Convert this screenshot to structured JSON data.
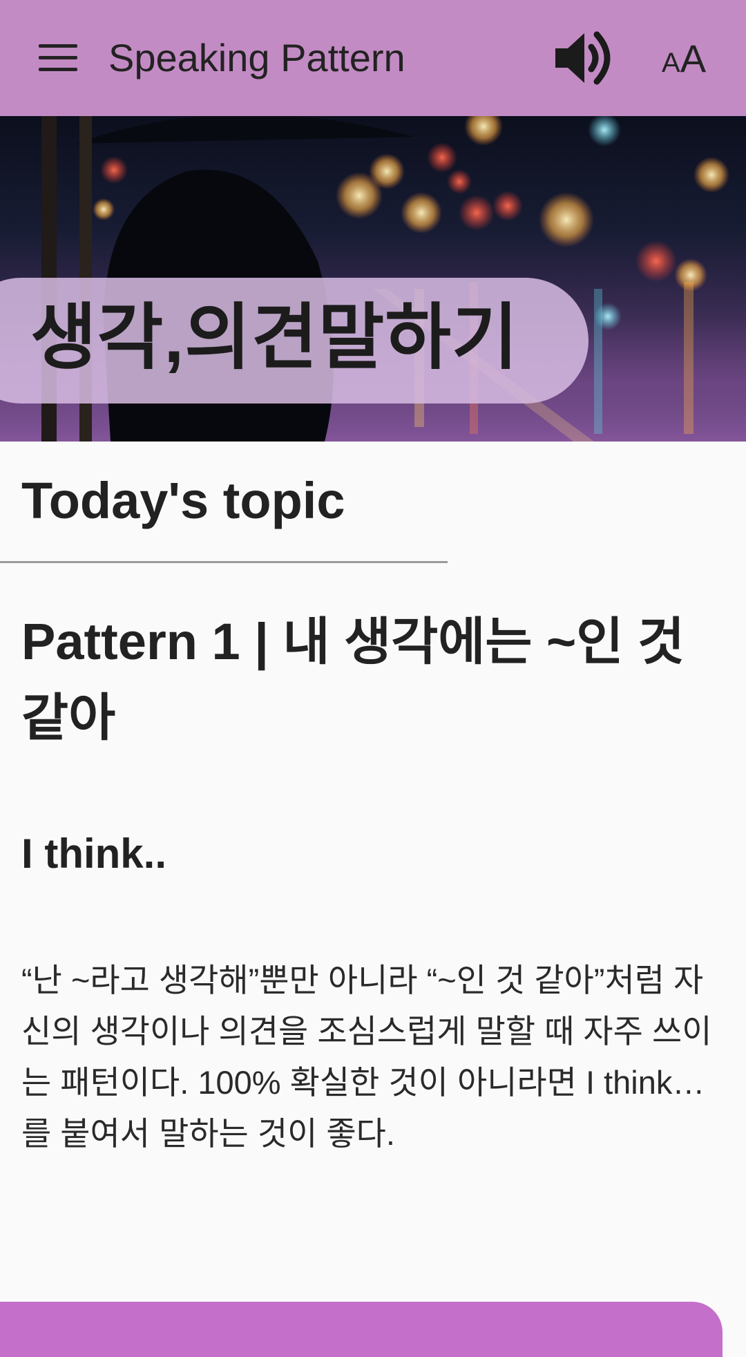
{
  "app_bar": {
    "title": "Speaking Pattern",
    "menu_icon": "menu-icon",
    "volume_icon": "volume-icon",
    "font_size_label_small": "A",
    "font_size_label_large": "A",
    "background_color": "#c38bc4"
  },
  "hero": {
    "title": "생각,의견말하기",
    "image": "rainy-city-street-night-photo"
  },
  "content": {
    "section_heading": "Today's topic",
    "pattern_title": "Pattern 1 | 내 생각에는 ~인 것 같아",
    "pattern_english": "I think..",
    "description": "“난 ~라고 생각해”뿐만 아니라 “~인 것 같아”처럼 자신의 생각이나 의견을 조심스럽게 말할 때 자주 쓰이는 패턴이다. 100% 확실한 것이 아니라면 I think…를 붙여서 말하는 것이 좋다."
  },
  "colors": {
    "accent": "#c38bc4",
    "bottom_bar": "#c46fca",
    "background": "#fafafa"
  }
}
